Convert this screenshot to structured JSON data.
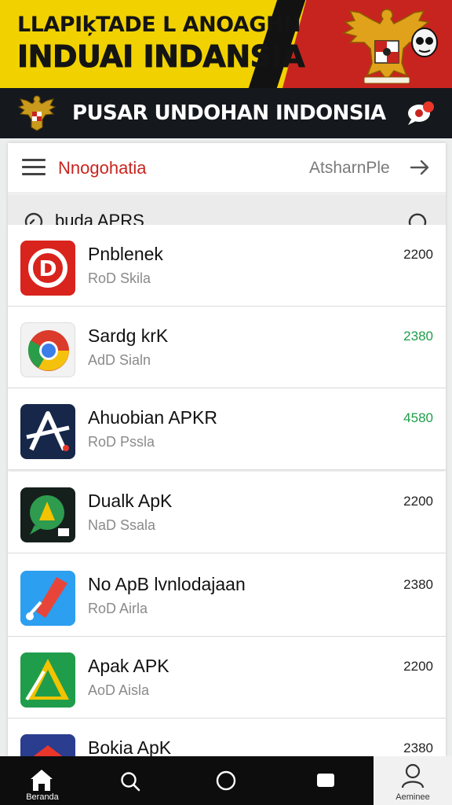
{
  "banner": {
    "line1": "LLAPIķTADE L ANOAGHN",
    "line2": "INDUAI INDANSIA"
  },
  "header": {
    "title": "PUSAR UNDOHAN INDONSIA"
  },
  "toolbar": {
    "title": "Nnogohatia",
    "hint": "AtsharnPle"
  },
  "search": {
    "value": "buda APRS"
  },
  "apps": [
    {
      "name": "Pnblenek",
      "sub": "RoD Skila",
      "count": "2200",
      "icon": "d-icon"
    },
    {
      "name": "Sardg krK",
      "sub": "AdD Sialn",
      "count": "2380",
      "icon": "browser-icon"
    },
    {
      "name": "Ahuobian APKR",
      "sub": "RoD Pssla",
      "count": "4580",
      "icon": "a-store-icon"
    },
    {
      "name": "Dualk ApK",
      "sub": "NaD Ssala",
      "count": "2200",
      "icon": "chat-bubble-icon"
    },
    {
      "name": "No ApB lvnlodajaan",
      "sub": "RoD Airla",
      "count": "2380",
      "icon": "pen-icon"
    },
    {
      "name": "Apak APK",
      "sub": "AoD Aisla",
      "count": "2200",
      "icon": "triangle-icon"
    },
    {
      "name": "Bokia ApK",
      "sub": "",
      "count": "2380",
      "icon": "shield-icon"
    }
  ],
  "nav": {
    "home": "Beranda",
    "account": "Aeminee"
  },
  "colors": {
    "banner_yellow": "#f1d200",
    "brand_red": "#c8241f",
    "header_dark": "#15191e",
    "count_green": "#1f9d4a"
  }
}
